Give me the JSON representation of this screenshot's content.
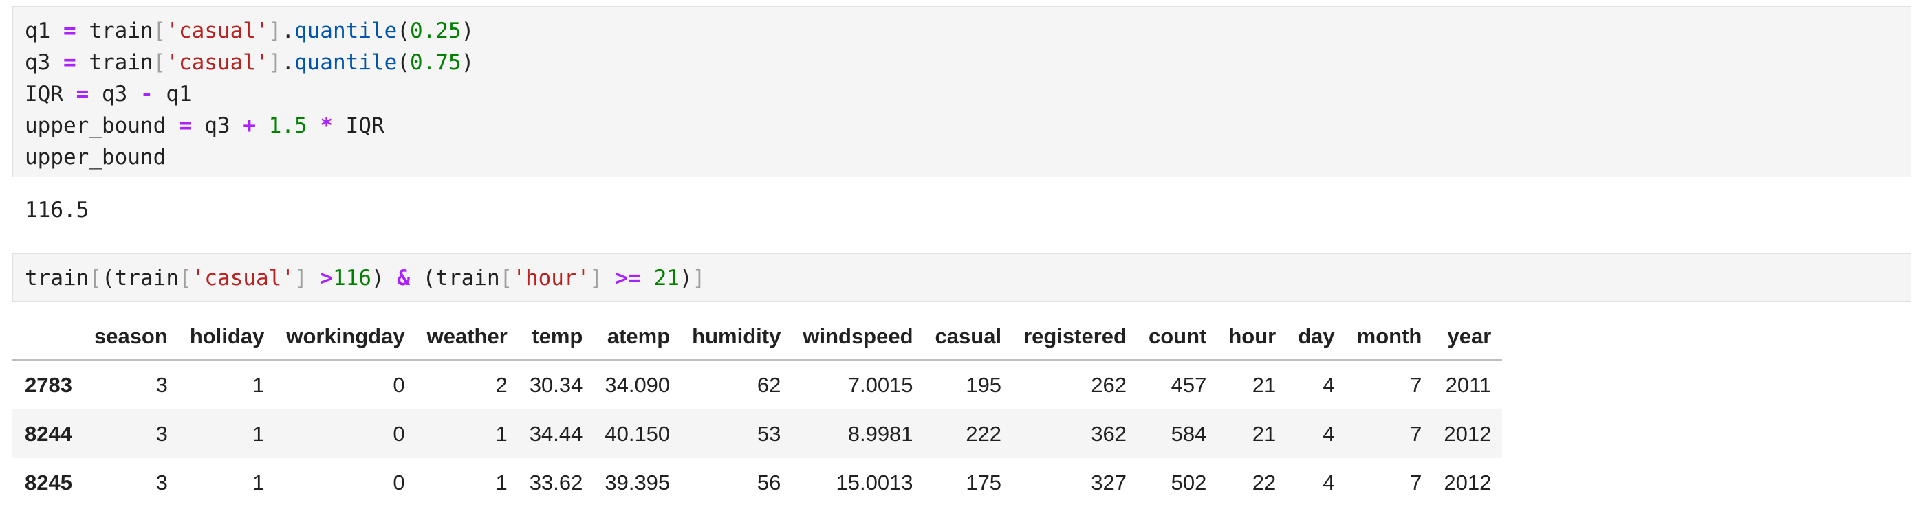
{
  "cell1": {
    "lines": [
      [
        {
          "t": "q1 "
        },
        {
          "t": "=",
          "c": "kw-op"
        },
        {
          "t": " train"
        },
        {
          "t": "[",
          "c": "br"
        },
        {
          "t": "'casual'",
          "c": "str"
        },
        {
          "t": "]",
          "c": "br"
        },
        {
          "t": "."
        },
        {
          "t": "quantile",
          "c": "fn"
        },
        {
          "t": "("
        },
        {
          "t": "0.25",
          "c": "num"
        },
        {
          "t": ")"
        }
      ],
      [
        {
          "t": "q3 "
        },
        {
          "t": "=",
          "c": "kw-op"
        },
        {
          "t": " train"
        },
        {
          "t": "[",
          "c": "br"
        },
        {
          "t": "'casual'",
          "c": "str"
        },
        {
          "t": "]",
          "c": "br"
        },
        {
          "t": "."
        },
        {
          "t": "quantile",
          "c": "fn"
        },
        {
          "t": "("
        },
        {
          "t": "0.75",
          "c": "num"
        },
        {
          "t": ")"
        }
      ],
      [
        {
          "t": "IQR "
        },
        {
          "t": "=",
          "c": "kw-op"
        },
        {
          "t": " q3 "
        },
        {
          "t": "-",
          "c": "kw-op"
        },
        {
          "t": " q1"
        }
      ],
      [
        {
          "t": "upper_bound "
        },
        {
          "t": "=",
          "c": "kw-op"
        },
        {
          "t": " q3 "
        },
        {
          "t": "+",
          "c": "kw-op"
        },
        {
          "t": " "
        },
        {
          "t": "1.5",
          "c": "num"
        },
        {
          "t": " "
        },
        {
          "t": "*",
          "c": "kw-op"
        },
        {
          "t": " IQR"
        }
      ],
      [
        {
          "t": "upper_bound"
        }
      ]
    ]
  },
  "output1": "116.5",
  "cell2": {
    "lines": [
      [
        {
          "t": "train"
        },
        {
          "t": "[",
          "c": "br"
        },
        {
          "t": "(train"
        },
        {
          "t": "[",
          "c": "br"
        },
        {
          "t": "'casual'",
          "c": "str"
        },
        {
          "t": "]",
          "c": "br"
        },
        {
          "t": " "
        },
        {
          "t": ">",
          "c": "kw-op"
        },
        {
          "t": "116",
          "c": "num"
        },
        {
          "t": ") "
        },
        {
          "t": "&",
          "c": "kw-op"
        },
        {
          "t": " (train"
        },
        {
          "t": "[",
          "c": "br"
        },
        {
          "t": "'hour'",
          "c": "str"
        },
        {
          "t": "]",
          "c": "br"
        },
        {
          "t": " "
        },
        {
          "t": ">=",
          "c": "kw-op"
        },
        {
          "t": " "
        },
        {
          "t": "21",
          "c": "num"
        },
        {
          "t": ")"
        },
        {
          "t": "]",
          "c": "br"
        }
      ]
    ]
  },
  "table": {
    "columns": [
      "",
      "season",
      "holiday",
      "workingday",
      "weather",
      "temp",
      "atemp",
      "humidity",
      "windspeed",
      "casual",
      "registered",
      "count",
      "hour",
      "day",
      "month",
      "year"
    ],
    "rows": [
      [
        "2783",
        "3",
        "1",
        "0",
        "2",
        "30.34",
        "34.090",
        "62",
        "7.0015",
        "195",
        "262",
        "457",
        "21",
        "4",
        "7",
        "2011"
      ],
      [
        "8244",
        "3",
        "1",
        "0",
        "1",
        "34.44",
        "40.150",
        "53",
        "8.9981",
        "222",
        "362",
        "584",
        "21",
        "4",
        "7",
        "2012"
      ],
      [
        "8245",
        "3",
        "1",
        "0",
        "1",
        "33.62",
        "39.395",
        "56",
        "15.0013",
        "175",
        "327",
        "502",
        "22",
        "4",
        "7",
        "2012"
      ]
    ]
  }
}
